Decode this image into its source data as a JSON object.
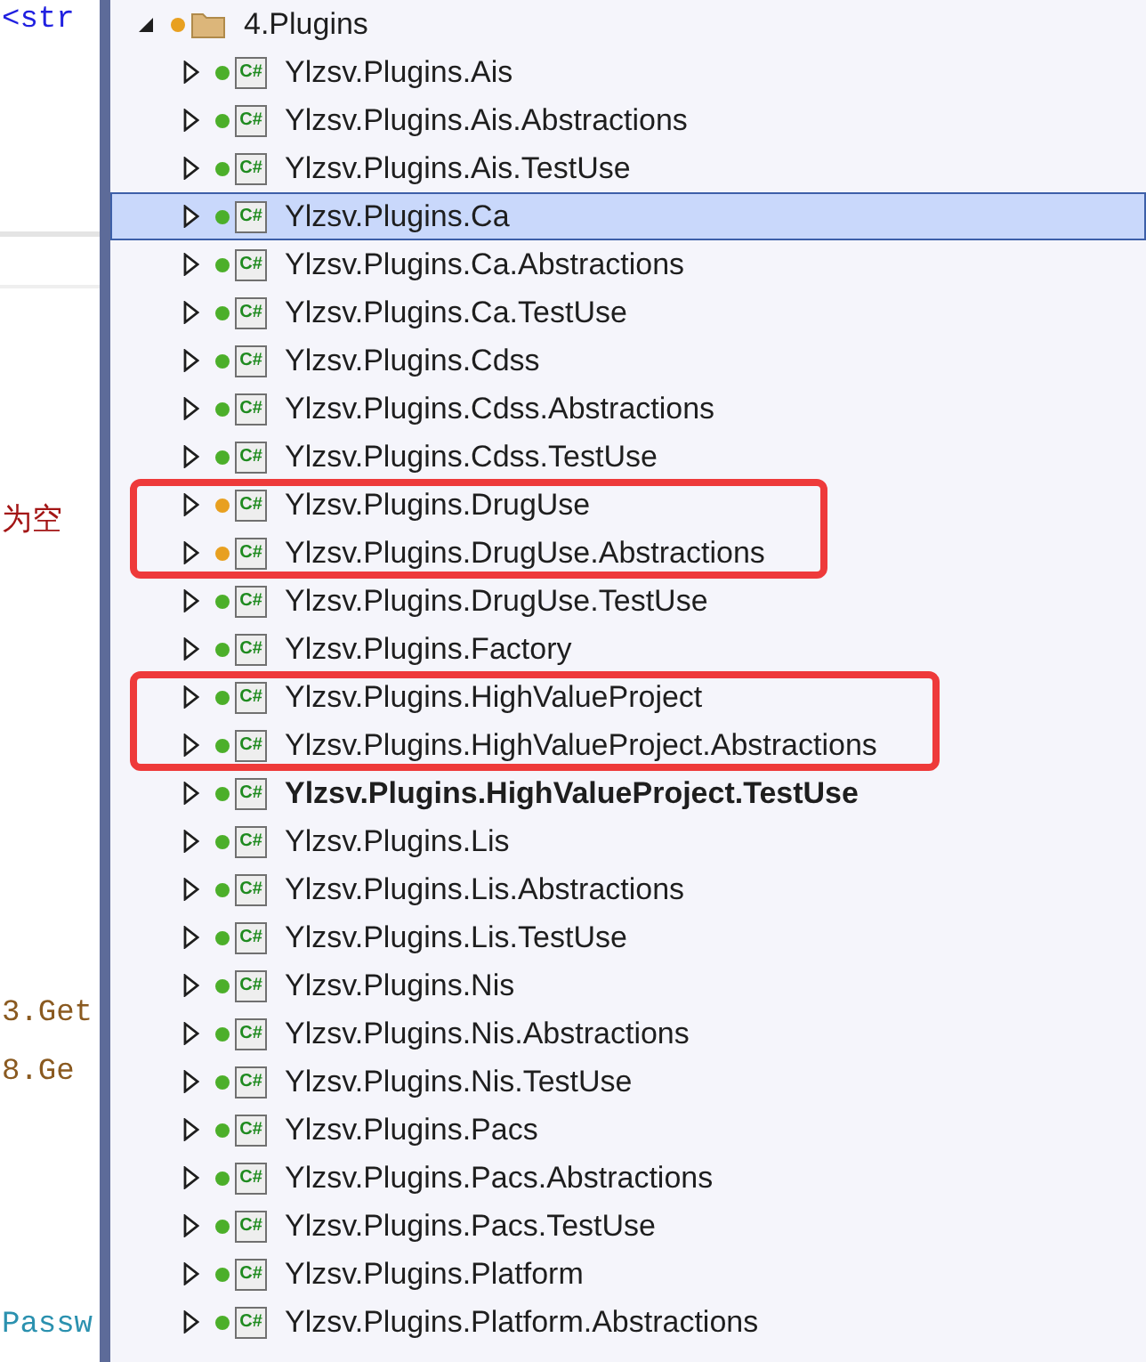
{
  "editor": {
    "lines": [
      {
        "text": "<str",
        "color": "#2020e0"
      },
      {
        "text": "为空",
        "color": "#a31515"
      },
      {
        "text": "3.Get",
        "color": "#8a5a20"
      },
      {
        "text": "8.Ge",
        "color": "#8a5a20"
      },
      {
        "text": "Passw",
        "color": "#2b91af"
      }
    ]
  },
  "solution_tree": {
    "folder": {
      "label": "4.Plugins",
      "expanded": true,
      "color": "#e8a020"
    },
    "items": [
      {
        "icon": "C#",
        "label": "Ylzsv.Plugins.Ais",
        "selected": false,
        "bold": false,
        "boxed": false,
        "color": "#4caf2a"
      },
      {
        "icon": "C#",
        "label": "Ylzsv.Plugins.Ais.Abstractions",
        "selected": false,
        "bold": false,
        "boxed": false,
        "color": "#4caf2a"
      },
      {
        "icon": "C#",
        "label": "Ylzsv.Plugins.Ais.TestUse",
        "selected": false,
        "bold": false,
        "boxed": false,
        "color": "#4caf2a"
      },
      {
        "icon": "C#",
        "label": "Ylzsv.Plugins.Ca",
        "selected": true,
        "bold": false,
        "boxed": false,
        "color": "#4caf2a"
      },
      {
        "icon": "C#",
        "label": "Ylzsv.Plugins.Ca.Abstractions",
        "selected": false,
        "bold": false,
        "boxed": false,
        "color": "#4caf2a"
      },
      {
        "icon": "C#",
        "label": "Ylzsv.Plugins.Ca.TestUse",
        "selected": false,
        "bold": false,
        "boxed": false,
        "color": "#4caf2a"
      },
      {
        "icon": "C#",
        "label": "Ylzsv.Plugins.Cdss",
        "selected": false,
        "bold": false,
        "boxed": false,
        "color": "#4caf2a"
      },
      {
        "icon": "C#",
        "label": "Ylzsv.Plugins.Cdss.Abstractions",
        "selected": false,
        "bold": false,
        "boxed": false,
        "color": "#4caf2a"
      },
      {
        "icon": "C#",
        "label": "Ylzsv.Plugins.Cdss.TestUse",
        "selected": false,
        "bold": false,
        "boxed": false,
        "color": "#4caf2a"
      },
      {
        "icon": "C#",
        "label": "Ylzsv.Plugins.DrugUse",
        "selected": false,
        "bold": false,
        "boxed": true,
        "color": "#e8a020"
      },
      {
        "icon": "C#",
        "label": "Ylzsv.Plugins.DrugUse.Abstractions",
        "selected": false,
        "bold": false,
        "boxed": true,
        "color": "#e8a020"
      },
      {
        "icon": "C#",
        "label": "Ylzsv.Plugins.DrugUse.TestUse",
        "selected": false,
        "bold": false,
        "boxed": false,
        "color": "#4caf2a"
      },
      {
        "icon": "C#",
        "label": "Ylzsv.Plugins.Factory",
        "selected": false,
        "bold": false,
        "boxed": false,
        "color": "#4caf2a"
      },
      {
        "icon": "C#",
        "label": "Ylzsv.Plugins.HighValueProject",
        "selected": false,
        "bold": false,
        "boxed": true,
        "color": "#4caf2a"
      },
      {
        "icon": "C#",
        "label": "Ylzsv.Plugins.HighValueProject.Abstractions",
        "selected": false,
        "bold": false,
        "boxed": true,
        "color": "#4caf2a"
      },
      {
        "icon": "C#",
        "label": "Ylzsv.Plugins.HighValueProject.TestUse",
        "selected": false,
        "bold": true,
        "boxed": false,
        "color": "#4caf2a"
      },
      {
        "icon": "C#",
        "label": "Ylzsv.Plugins.Lis",
        "selected": false,
        "bold": false,
        "boxed": false,
        "color": "#4caf2a"
      },
      {
        "icon": "C#",
        "label": "Ylzsv.Plugins.Lis.Abstractions",
        "selected": false,
        "bold": false,
        "boxed": false,
        "color": "#4caf2a"
      },
      {
        "icon": "C#",
        "label": "Ylzsv.Plugins.Lis.TestUse",
        "selected": false,
        "bold": false,
        "boxed": false,
        "color": "#4caf2a"
      },
      {
        "icon": "C#",
        "label": "Ylzsv.Plugins.Nis",
        "selected": false,
        "bold": false,
        "boxed": false,
        "color": "#4caf2a"
      },
      {
        "icon": "C#",
        "label": "Ylzsv.Plugins.Nis.Abstractions",
        "selected": false,
        "bold": false,
        "boxed": false,
        "color": "#4caf2a"
      },
      {
        "icon": "C#",
        "label": "Ylzsv.Plugins.Nis.TestUse",
        "selected": false,
        "bold": false,
        "boxed": false,
        "color": "#4caf2a"
      },
      {
        "icon": "C#",
        "label": "Ylzsv.Plugins.Pacs",
        "selected": false,
        "bold": false,
        "boxed": false,
        "color": "#4caf2a"
      },
      {
        "icon": "C#",
        "label": "Ylzsv.Plugins.Pacs.Abstractions",
        "selected": false,
        "bold": false,
        "boxed": false,
        "color": "#4caf2a"
      },
      {
        "icon": "C#",
        "label": "Ylzsv.Plugins.Pacs.TestUse",
        "selected": false,
        "bold": false,
        "boxed": false,
        "color": "#4caf2a"
      },
      {
        "icon": "C#",
        "label": "Ylzsv.Plugins.Platform",
        "selected": false,
        "bold": false,
        "boxed": false,
        "color": "#4caf2a"
      },
      {
        "icon": "C#",
        "label": "Ylzsv.Plugins.Platform.Abstractions",
        "selected": false,
        "bold": false,
        "boxed": false,
        "color": "#4caf2a"
      }
    ]
  }
}
